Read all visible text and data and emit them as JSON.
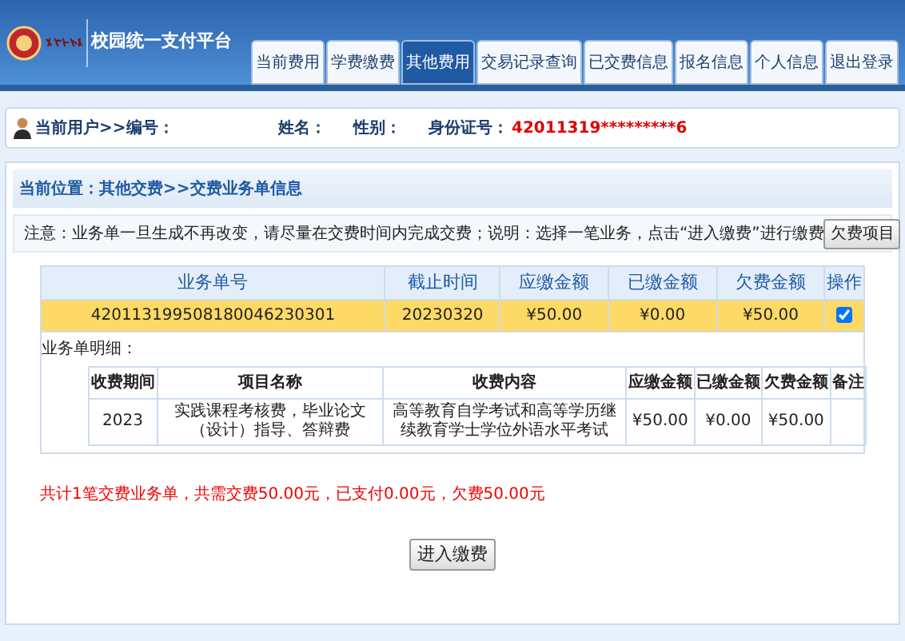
{
  "header": {
    "title": "校园统一支付平台",
    "tabs": [
      {
        "label": "当前费用",
        "selected": false
      },
      {
        "label": "学费缴费",
        "selected": false
      },
      {
        "label": "其他费用",
        "selected": true
      },
      {
        "label": "交易记录查询",
        "selected": false
      },
      {
        "label": "已交费信息",
        "selected": false
      },
      {
        "label": "报名信息",
        "selected": false
      },
      {
        "label": "个人信息",
        "selected": false
      },
      {
        "label": "退出登录",
        "selected": false
      }
    ]
  },
  "user_bar": {
    "number_label": "当前用户>>编号：",
    "name_label": "姓名：",
    "gender_label": "性别：",
    "id_card_label": "身份证号：",
    "id_card_value": "42011319*********6"
  },
  "breadcrumb": "当前位置：其他交费>>交费业务单信息",
  "notice": {
    "text": "注意：业务单一旦生成不再改变，请尽量在交费时间内完成交费；说明：选择一笔业务，点击“进入缴费”进行缴费",
    "button": "欠费项目"
  },
  "orders": {
    "columns": [
      "业务单号",
      "截止时间",
      "应缴金额",
      "已缴金额",
      "欠费金额",
      "操作"
    ],
    "rows": [
      {
        "order_no": "420113199508180046230301",
        "deadline": "20230320",
        "due": "¥50.00",
        "paid": "¥0.00",
        "owed": "¥50.00",
        "selected": true,
        "checked": true
      }
    ]
  },
  "detail": {
    "label": "业务单明细：",
    "columns": [
      "收费期间",
      "项目名称",
      "收费内容",
      "应缴金额",
      "已缴金额",
      "欠费金额",
      "备注"
    ],
    "rows": [
      {
        "period": "2023",
        "item": "实践课程考核费，毕业论文（设计）指导、答辩费",
        "content": "高等教育自学考试和高等学历继续教育学士学位外语水平考试",
        "due": "¥50.00",
        "paid": "¥0.00",
        "owed": "¥50.00"
      }
    ]
  },
  "summary": "共计1笔交费业务单，共需交费50.00元，已支付0.00元，欠费50.00元",
  "submit_button": "进入缴费"
}
